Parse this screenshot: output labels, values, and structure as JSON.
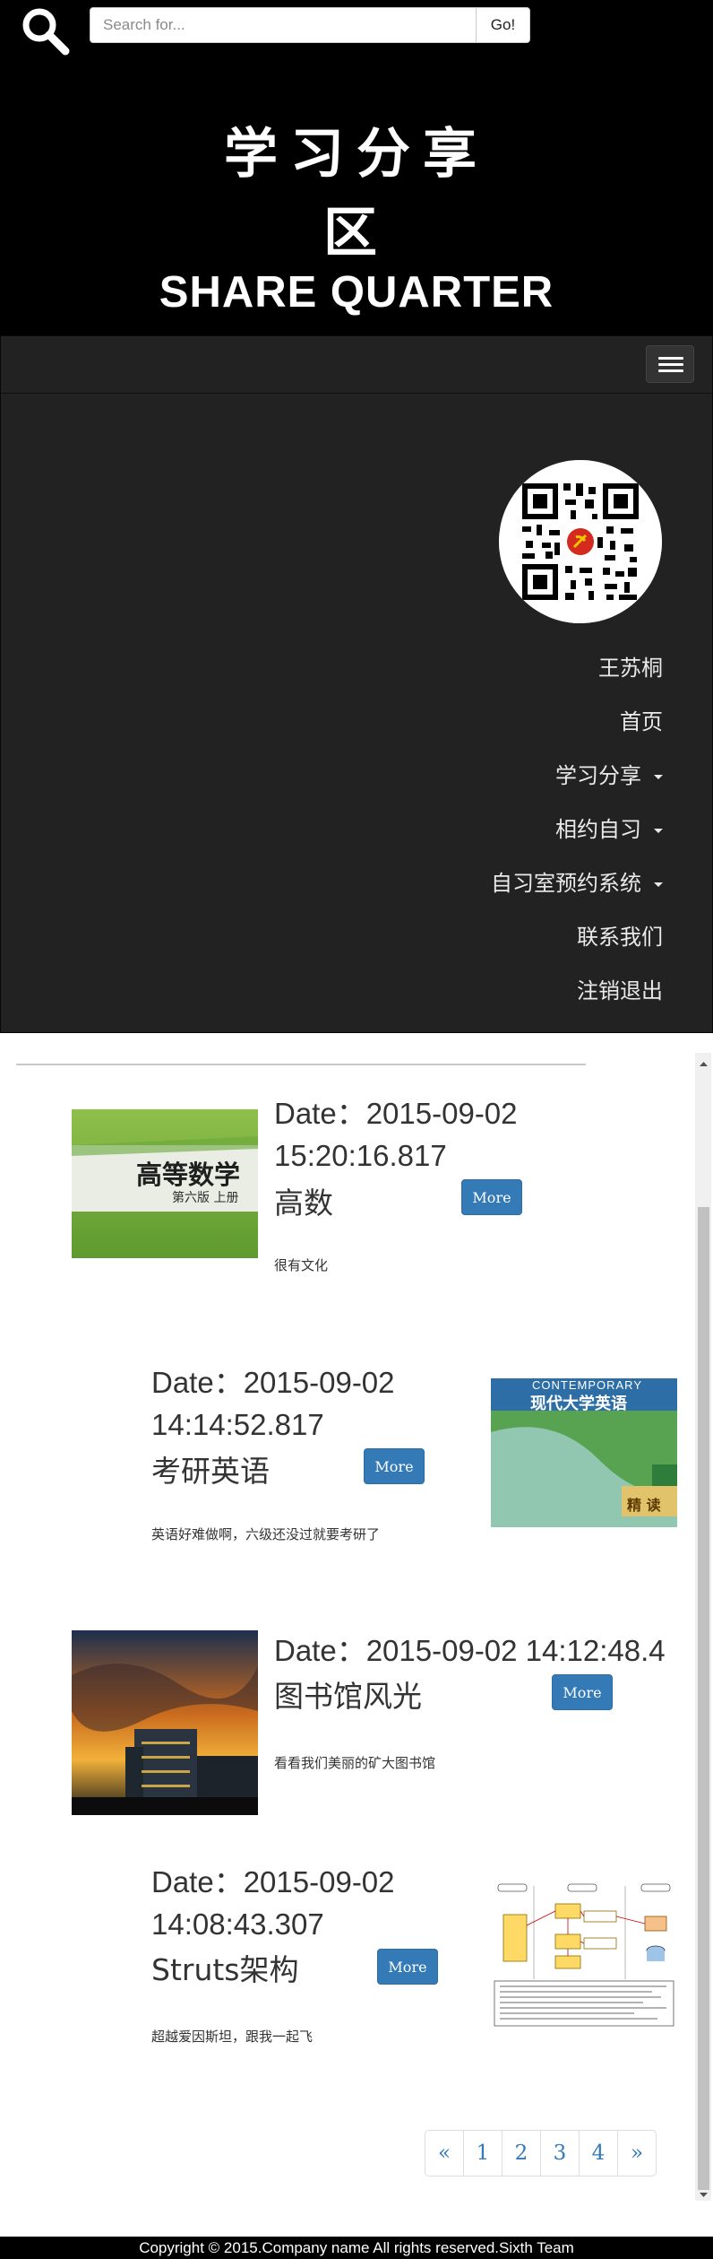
{
  "search": {
    "placeholder": "Search for...",
    "button_label": "Go!"
  },
  "header": {
    "title_line1": "学习分享",
    "title_line2": "区",
    "subtitle": "SHARE QUARTER"
  },
  "nav": {
    "user_name": "王苏桐",
    "items": [
      {
        "label": "首页",
        "dropdown": false
      },
      {
        "label": "学习分享",
        "dropdown": true
      },
      {
        "label": "相约自习",
        "dropdown": true
      },
      {
        "label": "自习室预约系统",
        "dropdown": true
      },
      {
        "label": "联系我们",
        "dropdown": false
      },
      {
        "label": "注销退出",
        "dropdown": false
      }
    ]
  },
  "posts": [
    {
      "date_line1": "Date：2015-09-02",
      "date_line2": "15:20:16.817",
      "title": "高数",
      "excerpt": "很有文化",
      "more_label": "More",
      "thumb_text": "高等数学",
      "thumb_subtext": "第六版 上册"
    },
    {
      "date_line1": "Date：2015-09-02",
      "date_line2": "14:14:52.817",
      "title": "考研英语",
      "excerpt": "英语好难做啊，六级还没过就要考研了",
      "more_label": "More",
      "thumb_text": "CONTEMPORARY",
      "thumb_subtext": "现代大学英语",
      "thumb_badge": "精 读"
    },
    {
      "date_line1": "Date：2015-09-02 14:12:48.4",
      "title": "图书馆风光",
      "excerpt": "看看我们美丽的矿大图书馆",
      "more_label": "More"
    },
    {
      "date_line1": "Date：2015-09-02",
      "date_line2": "14:08:43.307",
      "title": "Struts架构",
      "excerpt": "超越爱因斯坦，跟我一起飞",
      "more_label": "More"
    }
  ],
  "pagination": [
    "«",
    "1",
    "2",
    "3",
    "4",
    "»"
  ],
  "footer": {
    "text": "Copyright © 2015.Company name All rights reserved.Sixth Team"
  },
  "colors": {
    "header_bg": "#000000",
    "navbar_bg": "#222222",
    "primary": "#337ab7",
    "footer_bg": "#000000"
  },
  "icons": {
    "search": "search-icon",
    "menu": "hamburger-icon",
    "caret": "caret-down-icon"
  }
}
